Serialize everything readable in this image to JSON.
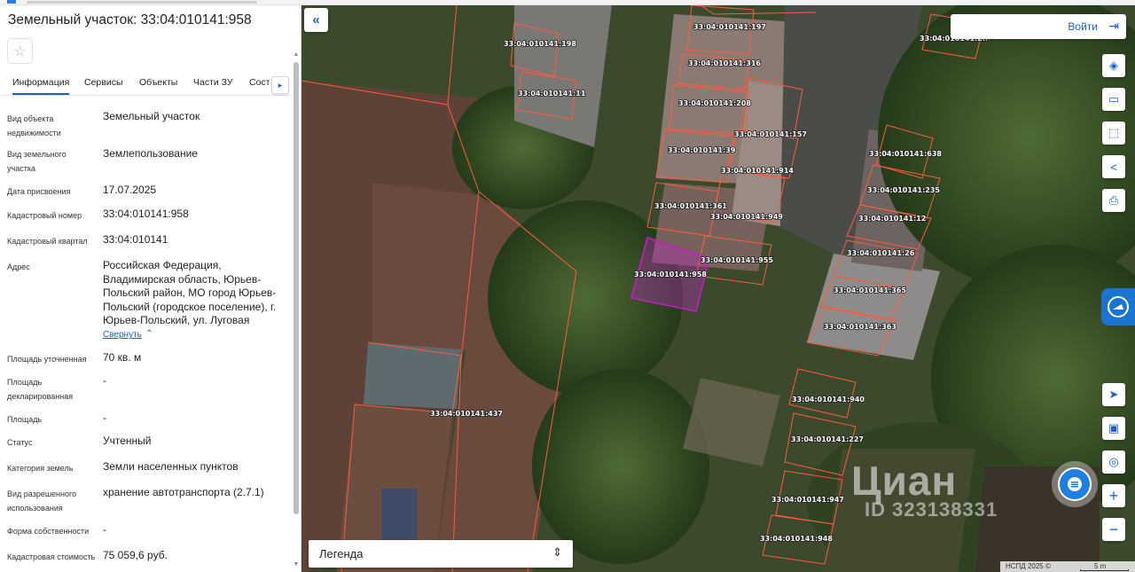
{
  "panel": {
    "title": "Земельный участок: 33:04:010141:958",
    "tabs": [
      "Информация",
      "Сервисы",
      "Объекты",
      "Части ЗУ",
      "Соста"
    ],
    "rows": [
      {
        "label": "Вид объекта недвижимости",
        "value": "Земельный участок"
      },
      {
        "label": "Вид земельного участка",
        "value": "Землепользование"
      },
      {
        "label": "Дата присвоения",
        "value": "17.07.2025"
      },
      {
        "label": "Кадастровый номер",
        "value": "33:04:010141:958"
      },
      {
        "label": "Кадастровый квартал",
        "value": "33:04:010141"
      },
      {
        "label": "Адрес",
        "value": "Российская Федерация, Владимирская область, Юрьев-Польский район, МО город Юрьев-Польский (городское поселение), г. Юрьев-Польский, ул. Луговая"
      },
      {
        "label": "Площадь уточненная",
        "value": "70 кв. м"
      },
      {
        "label": "Площадь декларированная",
        "value": "-"
      },
      {
        "label": "Площадь",
        "value": "-"
      },
      {
        "label": "Статус",
        "value": "Учтенный"
      },
      {
        "label": "Категория земель",
        "value": "Земли населенных пунктов"
      },
      {
        "label": "Вид разрешенного использования",
        "value": "хранение автотранспорта (2.7.1)"
      },
      {
        "label": "Форма собственности",
        "value": "-"
      },
      {
        "label": "Кадастровая стоимость",
        "value": "75 059,6 руб."
      }
    ],
    "collapse_link": "Свернуть"
  },
  "map": {
    "login_label": "Войти",
    "legend_label": "Легенда",
    "watermark": "Циан",
    "watermark_id": "ID 323138331",
    "copyright": "НСПД 2025 ©",
    "scale": "5 m",
    "parcels": [
      "33:04:010141:197",
      "33:04:010141:198",
      "33:04:010141:316",
      "33:04:010141:11",
      "33:04:010141:208",
      "33:04:010141:157",
      "33:04:010141:39",
      "33:04:010141:914",
      "33:04:010141:638",
      "33:04:010141:235",
      "33:04:010141:361",
      "33:04:010141:949",
      "33:04:010141:12",
      "33:04:010141:26",
      "33:04:010141:955",
      "33:04:010141:958",
      "33:04:010141:365",
      "33:04:010141:363",
      "33:04:010141:437",
      "33:04:010141:940",
      "33:04:010141:227",
      "33:04:010141:947",
      "33:04:010141:948",
      "33:04:010141:2.."
    ],
    "selected_parcel": "33:04:010141:958",
    "accent_color": "#1b5fc8",
    "selected_color": "#c21ec2",
    "boundary_color": "#ff5a3c"
  },
  "icons": {
    "favorite": "star-icon",
    "collapse": "double-chevron-left-icon",
    "login": "sign-in-icon",
    "tools": [
      "layers-icon",
      "ruler-icon",
      "select-area-icon",
      "share-icon",
      "print-icon",
      "geolocation-icon",
      "minimap-icon",
      "pin-search-icon",
      "zoom-in-icon",
      "zoom-out-icon"
    ]
  }
}
